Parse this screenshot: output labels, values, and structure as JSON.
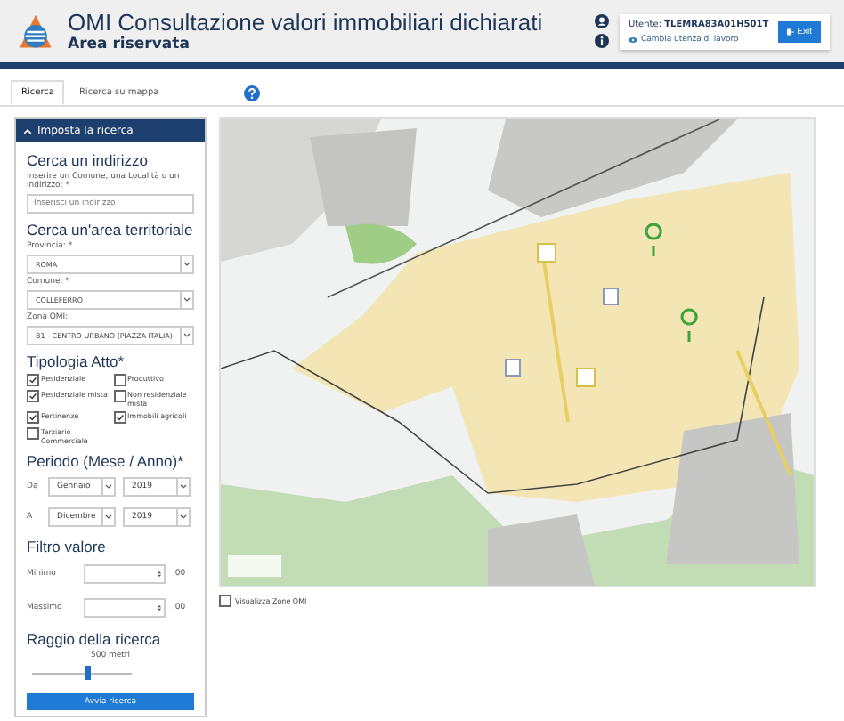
{
  "header": {
    "title": "OMI Consultazione valori immobiliari dichiarati",
    "subtitle": "Area riservata",
    "user_label": "Utente:",
    "user_id": "TLEMRA83A01H501T",
    "change_link": "Cambia utenza di lavoro",
    "exit_button": "Exit"
  },
  "tabs": [
    {
      "label": "Ricerca",
      "selected": true
    },
    {
      "label": "Ricerca su mappa",
      "selected": false
    }
  ],
  "panel": {
    "title": "Imposta la ricerca",
    "expanded": true,
    "address": {
      "heading": "Cerca un indirizzo",
      "label": "Inserire un Comune, una Località o un indirizzo: *",
      "placeholder": "Inserisci un indirizzo"
    },
    "area": {
      "heading": "Cerca un'area territoriale",
      "fields": [
        {
          "label": "Provincia: *",
          "value": "ROMA"
        },
        {
          "label": "Comune: *",
          "value": "COLLEFERRO"
        },
        {
          "label": "Zona OMI:",
          "value": "B1 - CENTRO URBANO (PIAZZA ITALIA)"
        }
      ]
    },
    "tipologia": {
      "heading": "Tipologia Atto*",
      "options": [
        {
          "label": "Residenziale",
          "checked": true
        },
        {
          "label": "Produttivo",
          "checked": false
        },
        {
          "label": "Residenziale mista",
          "checked": true
        },
        {
          "label": "Non residenziale mista",
          "checked": false
        },
        {
          "label": "Pertinenze",
          "checked": true
        },
        {
          "label": "Immobili agricoli",
          "checked": true
        },
        {
          "label": "Terziario Commerciale",
          "checked": false
        }
      ]
    },
    "periodo": {
      "heading": "Periodo (Mese / Anno)*",
      "rows": [
        {
          "label": "Da",
          "month": "Gennaio",
          "year": "2019"
        },
        {
          "label": "A",
          "month": "Dicembre",
          "year": "2019"
        }
      ]
    },
    "filtro": {
      "heading": "Filtro valore",
      "rows": [
        {
          "label": "Minimo",
          "suffix": ",00"
        },
        {
          "label": "Massimo",
          "suffix": ",00"
        }
      ]
    },
    "raggio": {
      "heading": "Raggio della ricerca",
      "reading": "500 metri",
      "level": 0.55
    },
    "button": "Avvia ricerca"
  },
  "map": {
    "zones_checkbox": {
      "label": "Visualizza Zone OMI",
      "checked": false
    }
  }
}
